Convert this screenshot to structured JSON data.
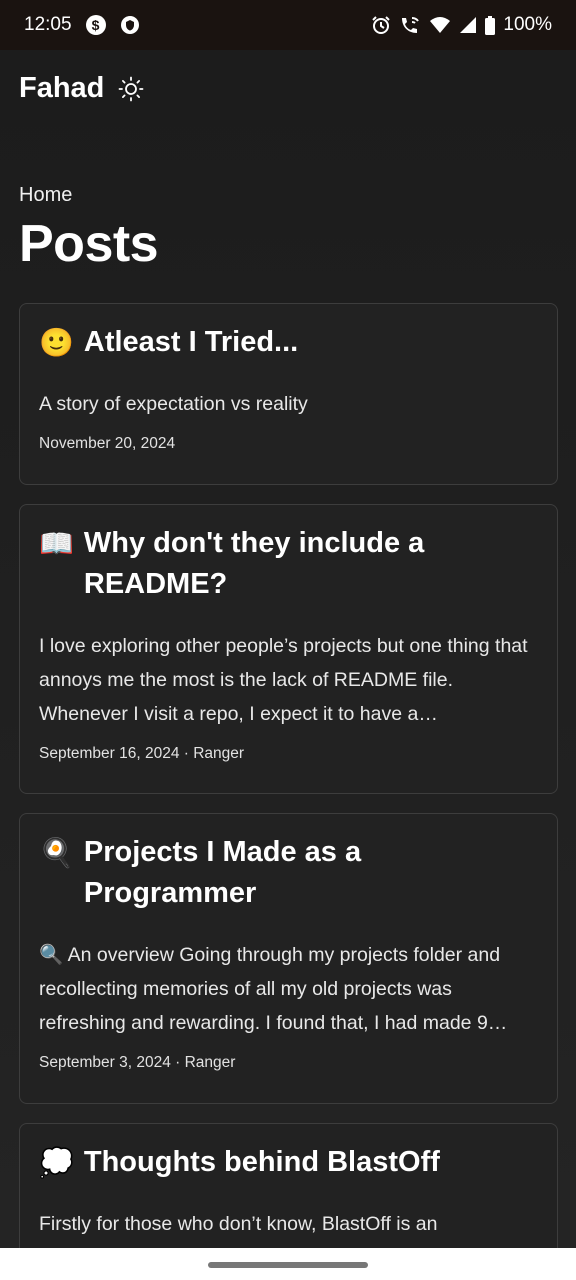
{
  "status_bar": {
    "time": "12:05",
    "left_icons": [
      "dollar-icon",
      "shield-icon"
    ],
    "right_icons": [
      "alarm-icon",
      "wifi-calling-icon",
      "wifi-icon",
      "signal-icon",
      "battery-icon"
    ],
    "battery": "100%"
  },
  "header": {
    "site_title": "Fahad",
    "theme_icon": "sun-icon"
  },
  "breadcrumb": "Home",
  "page_title": "Posts",
  "posts": [
    {
      "emoji": "🙂",
      "title": "Atleast I Tried...",
      "excerpt": "A story of expectation vs reality",
      "meta": "November 20, 2024"
    },
    {
      "emoji": "📖",
      "title": "Why don't they include a README?",
      "excerpt": "I love exploring other people’s projects but one thing that annoys me the most is the lack of README file. Whenever I visit a repo, I expect it to have a…",
      "meta": "September 16, 2024 · Ranger"
    },
    {
      "emoji": "🍳",
      "title": "Projects I Made as a Programmer",
      "excerpt": "🔍 An overview Going through my projects folder and recollecting memories of all my old projects was refreshing and rewarding. I found that, I had made 9…",
      "meta": "September 3, 2024 · Ranger"
    },
    {
      "emoji": "💭",
      "title": "Thoughts behind BlastOff",
      "excerpt": "Firstly for those who don’t know, BlastOff is an",
      "meta": ""
    }
  ]
}
